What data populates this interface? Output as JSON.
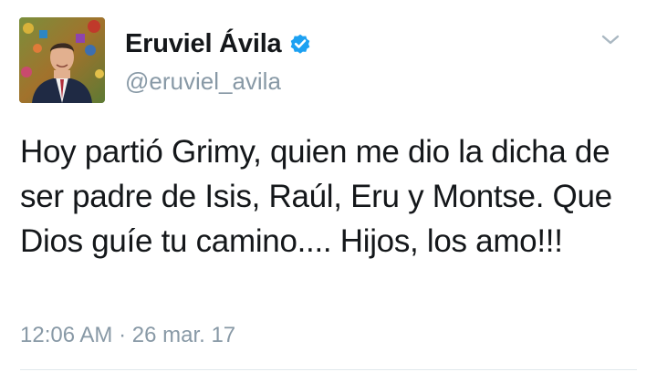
{
  "user": {
    "display_name": "Eruviel Ávila",
    "handle": "@eruviel_avila",
    "verified": true,
    "avatar_icon": "profile-photo"
  },
  "tweet": {
    "text": "Hoy partió Grimy, quien me dio la dicha de ser padre de Isis, Raúl, Eru y Montse. Que Dios guíe tu camino.... Hijos, los amo!!!",
    "time": "12:06 AM",
    "separator": "·",
    "date": "26 mar. 17"
  },
  "icons": {
    "verified": "verified-badge-icon",
    "menu": "chevron-down-icon"
  },
  "colors": {
    "verified_blue": "#1da1f2",
    "secondary_text": "#8899a6",
    "primary_text": "#14171a"
  }
}
